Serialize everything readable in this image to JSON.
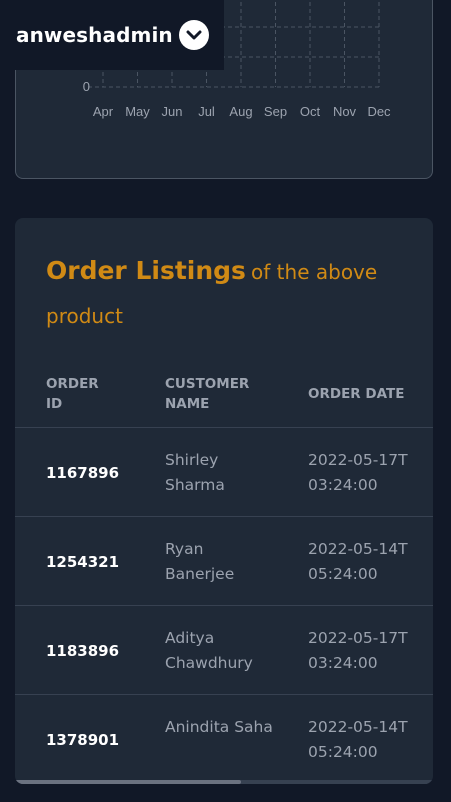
{
  "user": {
    "name": "anweshadmin",
    "toggle_icon": "chevron-down-icon"
  },
  "chart_data": {
    "type": "line",
    "categories": [
      "Apr",
      "May",
      "Jun",
      "Jul",
      "Aug",
      "Sep",
      "Oct",
      "Nov",
      "Dec"
    ],
    "y_ticks_visible": [
      "0"
    ],
    "grid": true
  },
  "orders": {
    "title": "Order Listings",
    "subtitle": "of the above product",
    "columns": [
      "ORDER ID",
      "CUSTOMER NAME",
      "ORDER DATE"
    ],
    "rows": [
      {
        "id": "1167896",
        "name": "Shirley Sharma",
        "date": "2022-05-17T03:24:00"
      },
      {
        "id": "1254321",
        "name": "Ryan Banerjee",
        "date": "2022-05-14T05:24:00"
      },
      {
        "id": "1183896",
        "name": "Aditya Chawdhury",
        "date": "2022-05-17T03:24:00"
      },
      {
        "id": "1378901",
        "name": "Anindita Saha",
        "date": "2022-05-14T05:24:00"
      }
    ]
  },
  "colors": {
    "accent": "#d08a15",
    "background": "#111827",
    "card": "#1f2937"
  }
}
